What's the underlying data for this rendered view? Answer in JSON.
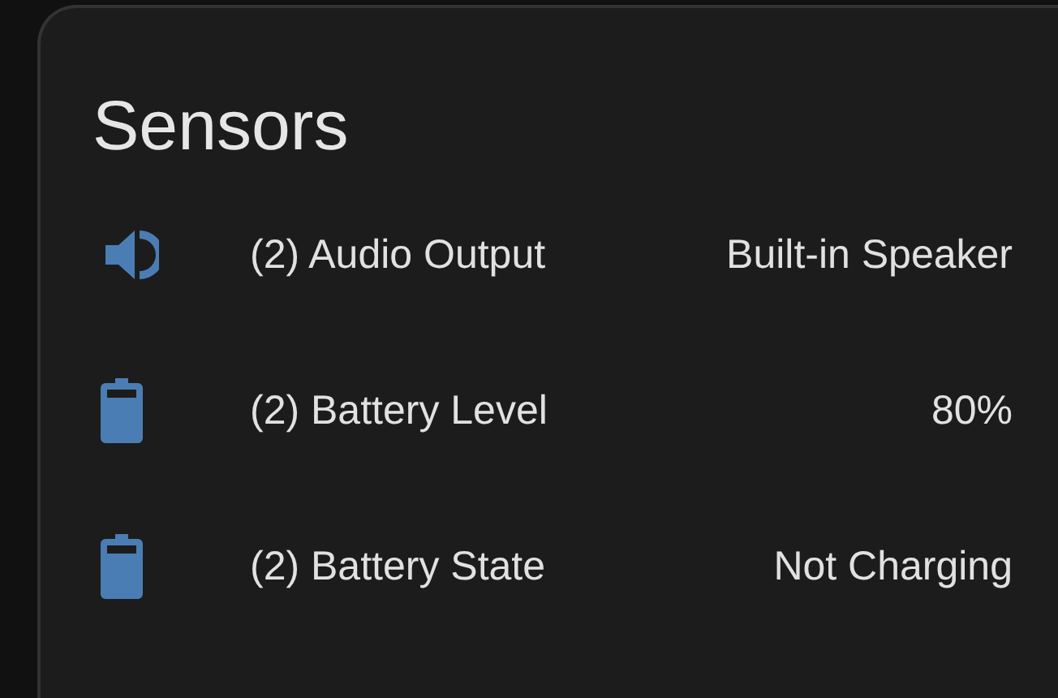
{
  "card": {
    "title": "Sensors",
    "rows": [
      {
        "kind": "speaker",
        "name": "(2) Audio Output",
        "value": "Built-in Speaker"
      },
      {
        "kind": "battery",
        "name": "(2) Battery Level",
        "value": "80%"
      },
      {
        "kind": "battery",
        "name": "(2) Battery State",
        "value": "Not Charging"
      }
    ]
  }
}
